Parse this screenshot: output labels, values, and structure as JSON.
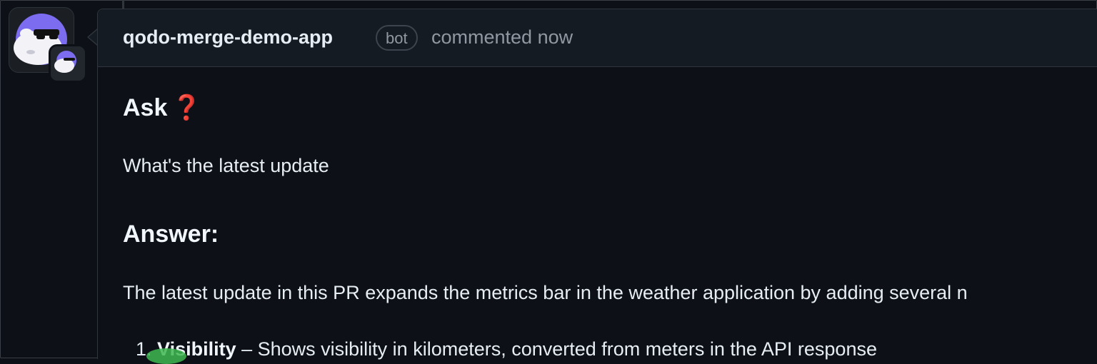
{
  "comment": {
    "author": "qodo-merge-demo-app",
    "badge": "bot",
    "meta": "commented now",
    "ask_heading": "Ask",
    "question": "What's the latest update",
    "answer_heading": "Answer:",
    "answer_text": "The latest update in this PR expands the metrics bar in the weather application by adding several n",
    "list": [
      {
        "number": "1.",
        "term": "Visibility",
        "separator": " – ",
        "description": "Shows visibility in kilometers, converted from meters in the API response"
      }
    ]
  },
  "icons": {
    "avatar": "bot-avatar-icon",
    "avatar_badge": "app-avatar-icon",
    "question_mark": "red-question-mark-icon"
  },
  "colors": {
    "background": "#0d1117",
    "header_background": "#151b23",
    "border": "#30363d",
    "text": "#e6edf3",
    "muted_text": "#9198a1",
    "question_mark": "#e5242f",
    "avatar_purple": "#7c6cf0"
  }
}
